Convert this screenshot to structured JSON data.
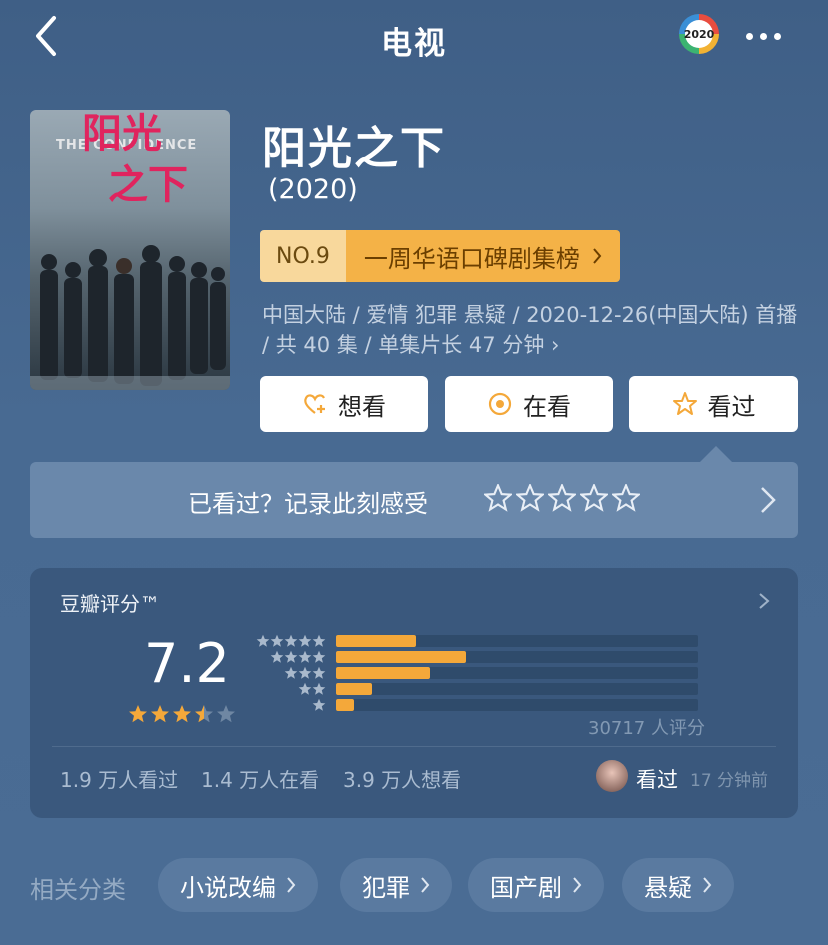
{
  "header": {
    "title": "电视",
    "badge": "2020"
  },
  "show": {
    "name": "阳光之下",
    "year": "(2020)",
    "poster_title_line1": "阳光",
    "poster_title_line2": "之下",
    "poster_english": "THE CONFIDENCE",
    "rank_no": "NO.9",
    "rank_list": "一周华语口碑剧集榜",
    "meta": "中国大陆 / 爱情 犯罪 悬疑 / 2020-12-26(中国大陆) 首播 / 共 40 集 / 单集片长 47 分钟"
  },
  "actions": [
    {
      "label": "想看",
      "icon": "heart-plus-icon"
    },
    {
      "label": "在看",
      "icon": "circle-dot-icon"
    },
    {
      "label": "看过",
      "icon": "star-outline-icon"
    }
  ],
  "watched": {
    "prompt": "已看过？记录此刻感受",
    "stars": 5
  },
  "rating": {
    "label": "豆瓣评分™",
    "score": "7.2",
    "star_value": 3.5,
    "distribution": [
      0.22,
      0.36,
      0.26,
      0.1,
      0.05
    ],
    "votes_text": "30717 人评分",
    "stats": [
      "1.9 万人看过",
      "1.4 万人在看",
      "3.9 万人想看"
    ],
    "friend_status": "看过",
    "friend_time": "17 分钟前"
  },
  "categories": {
    "label": "相关分类",
    "tags": [
      "小说改编",
      "犯罪",
      "国产剧",
      "悬疑"
    ]
  },
  "colors": {
    "accent": "#f4a83a",
    "background": "#4a6a90"
  }
}
